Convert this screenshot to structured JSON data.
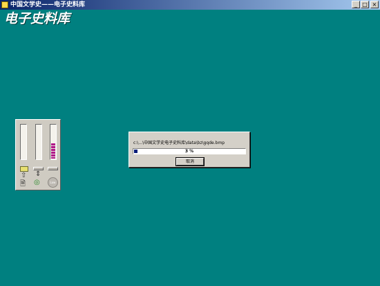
{
  "window": {
    "title": "中国文学史——电子史料库",
    "controls": {
      "minimize": "_",
      "maximize": "□",
      "close": "×"
    }
  },
  "brand": {
    "text": "电子史料库"
  },
  "meter_panel": {
    "meters": [
      {
        "name": "meter-1",
        "level": 0.0
      },
      {
        "name": "meter-2",
        "level": 0.0
      },
      {
        "name": "meter-3",
        "level": 0.45
      }
    ],
    "icons": [
      "folder-icon",
      "bar-indicator-icon",
      "bar-indicator-icon",
      "arrow-up-icon",
      "arrow-updown-icon",
      "document-icon",
      "cd-icon",
      "disc-icon"
    ],
    "disc_label": "Low"
  },
  "progress_dialog": {
    "path": "c:\\...\\中国文学史电子史料库\\data\\bz\\gqde.bmp",
    "percent": 3,
    "percent_text": "3 %",
    "cancel_label": "取消"
  },
  "colors": {
    "desktop": "#008080",
    "titlebar_start": "#0a246a",
    "titlebar_end": "#a6caf0",
    "progress": "#0a1e7a",
    "meter_fill": "#b0188a"
  }
}
